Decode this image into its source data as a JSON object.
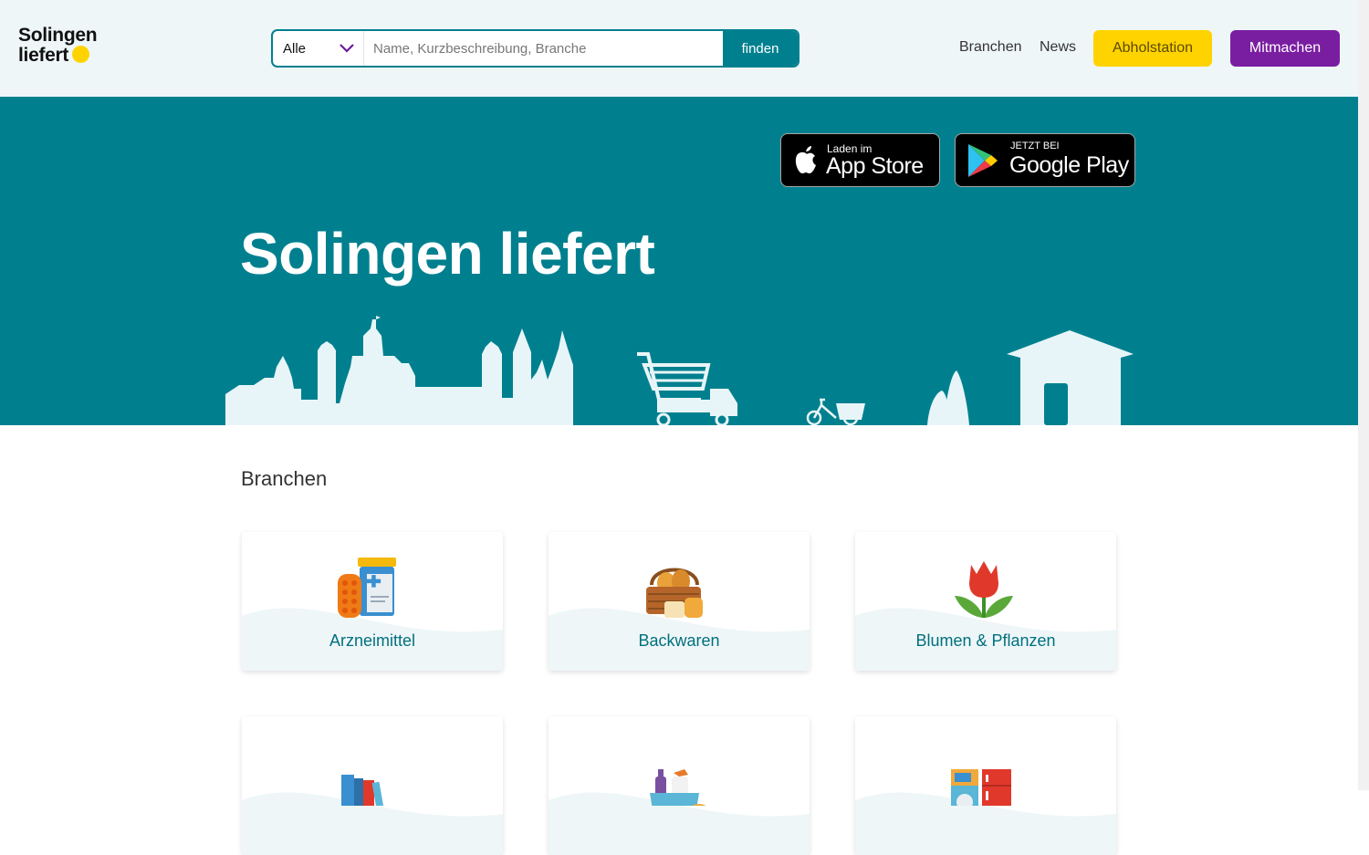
{
  "header": {
    "logo_line1": "Solingen",
    "logo_line2": "liefert",
    "search_category": "Alle",
    "search_placeholder": "Name, Kurzbeschreibung, Branche",
    "search_button": "finden",
    "nav_branchen": "Branchen",
    "nav_news": "News",
    "btn_abholstation": "Abholstation",
    "btn_mitmachen": "Mitmachen"
  },
  "hero": {
    "title": "Solingen liefert",
    "appstore_small": "Laden im",
    "appstore_big": "App Store",
    "googleplay_small": "JETZT BEI",
    "googleplay_big": "Google Play"
  },
  "main": {
    "section_title": "Branchen",
    "categories": [
      {
        "label": "Arzneimittel",
        "icon": "medicine-icon"
      },
      {
        "label": "Backwaren",
        "icon": "bread-basket-icon"
      },
      {
        "label": "Blumen & Pflanzen",
        "icon": "tulip-icon"
      },
      {
        "label": "",
        "icon": "books-icon"
      },
      {
        "label": "",
        "icon": "cleaning-supplies-icon"
      },
      {
        "label": "",
        "icon": "appliances-icon"
      }
    ]
  },
  "colors": {
    "teal": "#00808f",
    "yellow": "#ffd300",
    "purple": "#7a1ea1",
    "header_bg": "#eef6f8"
  }
}
